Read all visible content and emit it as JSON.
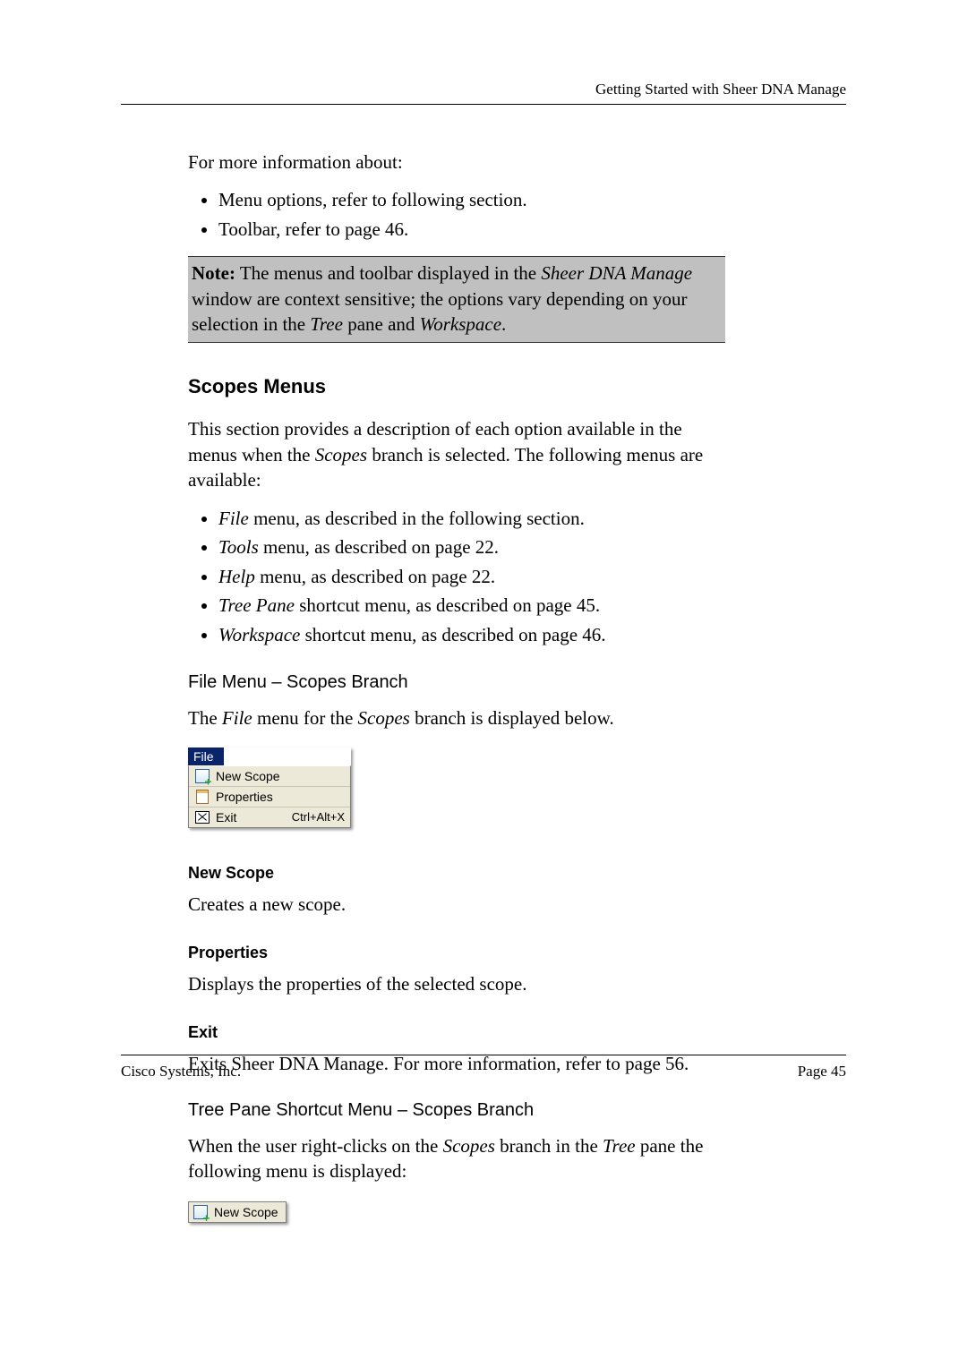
{
  "running_head": "Getting Started with Sheer DNA Manage",
  "intro_text": "For more information about:",
  "intro_bullets": [
    "Menu options, refer to following section.",
    "Toolbar, refer to page 46."
  ],
  "note": {
    "label": "Note:",
    "t1": " The menus and toolbar displayed in the ",
    "i1": "Sheer DNA Manage",
    "t2": " window are context sensitive; the options vary depending on your selection in the ",
    "i2": "Tree",
    "t3": " pane and ",
    "i3": "Workspace",
    "t4": "."
  },
  "scopes_heading": "Scopes Menus",
  "scopes_para": {
    "t1": "This section provides a description of each option available in the menus when the ",
    "i1": "Scopes",
    "t2": " branch is selected. The following menus are available:"
  },
  "scopes_bullets": [
    {
      "i": "File",
      "t": " menu, as described in the following section."
    },
    {
      "i": "Tools",
      "t": " menu, as described on page 22."
    },
    {
      "i": "Help",
      "t": " menu, as described on page 22."
    },
    {
      "i": "Tree Pane",
      "t": " shortcut menu, as described on page 45."
    },
    {
      "i": "Workspace",
      "t": " shortcut menu, as described on page 46."
    }
  ],
  "file_menu_heading": "File Menu – Scopes Branch",
  "file_menu_para": {
    "t1": "The ",
    "i1": "File",
    "t2": " menu for the ",
    "i2": "Scopes",
    "t3": " branch is displayed below."
  },
  "menu_shot": {
    "title": "File",
    "items": [
      {
        "label": "New Scope",
        "accel": "",
        "icon": "newscope"
      },
      {
        "label": "Properties",
        "accel": "",
        "icon": "props"
      },
      {
        "label": "Exit",
        "accel": "Ctrl+Alt+X",
        "icon": "exit"
      }
    ]
  },
  "defs": [
    {
      "h": "New Scope",
      "p": "Creates a new scope."
    },
    {
      "h": "Properties",
      "p": "Displays the properties of the selected scope."
    },
    {
      "h": "Exit",
      "p": "Exits Sheer DNA Manage. For more information, refer to page 56."
    }
  ],
  "treepane_heading": "Tree Pane Shortcut Menu – Scopes Branch",
  "treepane_para": {
    "t1": "When the user right-clicks on the ",
    "i1": "Scopes",
    "t2": " branch in the ",
    "i2": "Tree",
    "t3": " pane the following menu is displayed:"
  },
  "ctx_item": {
    "label": "New Scope"
  },
  "footer_left": "Cisco Systems, Inc.",
  "footer_right": "Page 45"
}
